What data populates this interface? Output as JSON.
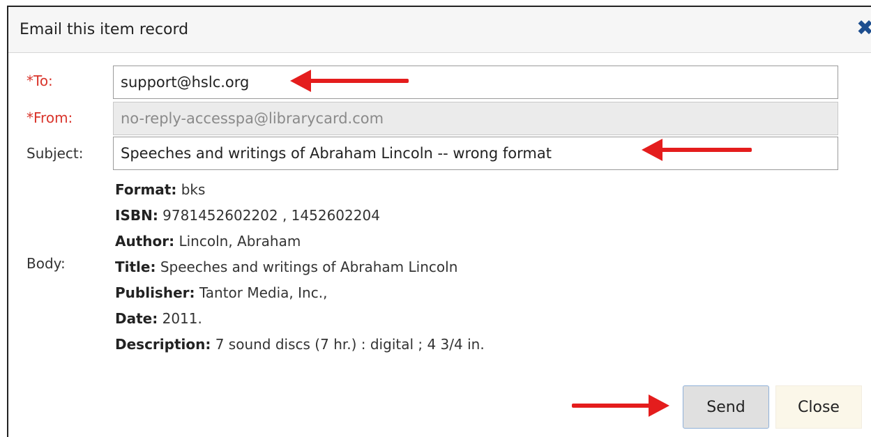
{
  "dialog": {
    "title": "Email this item record",
    "close_icon": "close-x-icon"
  },
  "form": {
    "to": {
      "label": "*To:",
      "value": "support@hslc.org"
    },
    "from": {
      "label": "*From:",
      "value": "no-reply-accesspa@librarycard.com"
    },
    "subject": {
      "label": "Subject:",
      "value": "Speeches and writings of Abraham Lincoln -- wrong format"
    },
    "body": {
      "label": "Body:",
      "lines": [
        {
          "key": "Format:",
          "value": " bks"
        },
        {
          "key": "ISBN:",
          "value": " 9781452602202 , 1452602204"
        },
        {
          "key": "Author:",
          "value": " Lincoln, Abraham"
        },
        {
          "key": "Title:",
          "value": " Speeches and writings of Abraham Lincoln"
        },
        {
          "key": "Publisher:",
          "value": " Tantor Media, Inc.,"
        },
        {
          "key": "Date:",
          "value": " 2011."
        },
        {
          "key": "Description:",
          "value": " 7 sound discs (7 hr.) : digital ; 4 3/4 in."
        }
      ]
    }
  },
  "buttons": {
    "send_label": "Send",
    "close_label": "Close"
  },
  "colors": {
    "required_label": "#d9342b",
    "annotation_arrow": "#e41d1d",
    "close_icon": "#1d4e8f"
  }
}
